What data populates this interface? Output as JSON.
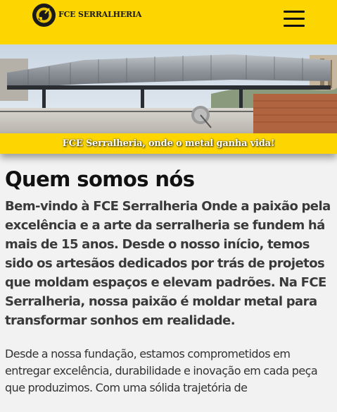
{
  "header": {
    "brand": "FCE SERRALHERIA",
    "logo_icon": "gear-welding-logo",
    "menu_icon": "hamburger-menu-icon",
    "brand_color": "#fdd500"
  },
  "hero": {
    "image": "building-rooftop-metal-structure-photo",
    "caption": "FCE Serralheria, onde o metal ganha vida!"
  },
  "about": {
    "title": "Quem somos nós",
    "lead": "Bem-vindo à FCE Serralheria Onde a paixão pela excelência e a arte da serralheria se fundem há mais de 15 anos. Desde o nosso início, temos sido os artesãos dedicados por trás de projetos que moldam espaços e elevam padrões. Na FCE Serralheria, nossa paixão é moldar metal para transformar sonhos em realidade.",
    "body": "Desde a nossa fundação, estamos comprometidos em entregar excelência, durabilidade e inovação em cada peça que produzimos. Com uma sólida trajetória de"
  }
}
